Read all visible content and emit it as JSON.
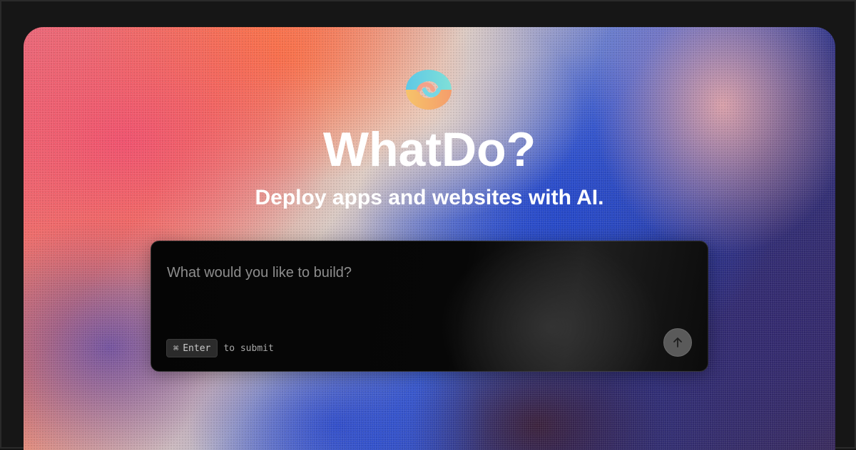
{
  "brand": {
    "logo_icon": "interlocking-rings-logo-icon",
    "title": "WhatDo?",
    "tagline": "Deploy apps and websites with AI."
  },
  "prompt": {
    "placeholder": "What would you like to build?",
    "value": "",
    "shortcut_symbol": "⌘",
    "shortcut_key": "Enter",
    "shortcut_hint": "to submit",
    "submit_icon": "arrow-up-icon"
  },
  "colors": {
    "frame_background": "#161616",
    "prompt_background": "#050505",
    "submit_button": "#5a5a5a",
    "text": "#ffffff"
  }
}
